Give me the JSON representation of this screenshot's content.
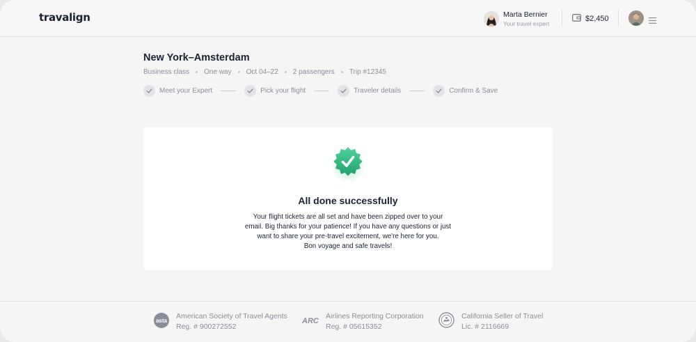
{
  "header": {
    "logo": "travalign",
    "expert_name": "Marta Bernier",
    "expert_role": "Your travel expert",
    "wallet_balance": "$2,450"
  },
  "trip": {
    "title": "New York–Amsterdam",
    "meta": [
      "Business class",
      "One way",
      "Oct 04–22",
      "2 passengers",
      "Trip #12345"
    ]
  },
  "steps": [
    {
      "label": "Meet your Expert",
      "done": true
    },
    {
      "label": "Pick your flight",
      "done": true
    },
    {
      "label": "Traveler details",
      "done": true
    },
    {
      "label": "Confirm & Save",
      "done": true
    }
  ],
  "success": {
    "title": "All done successfully",
    "lines": [
      "Your flight tickets are all set and have been zipped over to your",
      "email. Big thanks for your patience! If you have any questions or just",
      "want to share your pre-travel excitement, we're here for you.",
      "Bon voyage and safe travels!"
    ]
  },
  "footer": {
    "accreditations": [
      {
        "logo": "asta",
        "name": "American Society of Travel Agents",
        "reg": "Reg. # 900272552"
      },
      {
        "logo": "ARC",
        "name": "Airlines Reporting Corporation",
        "reg": "Reg. # 05615352"
      },
      {
        "logo": "california-seal",
        "name": "California Seller of Travel",
        "reg": "Lic. # 2116669"
      }
    ]
  },
  "colors": {
    "accent_green": "#3fc08a",
    "text_dark": "#1c2233",
    "text_muted": "#8b8e97"
  }
}
